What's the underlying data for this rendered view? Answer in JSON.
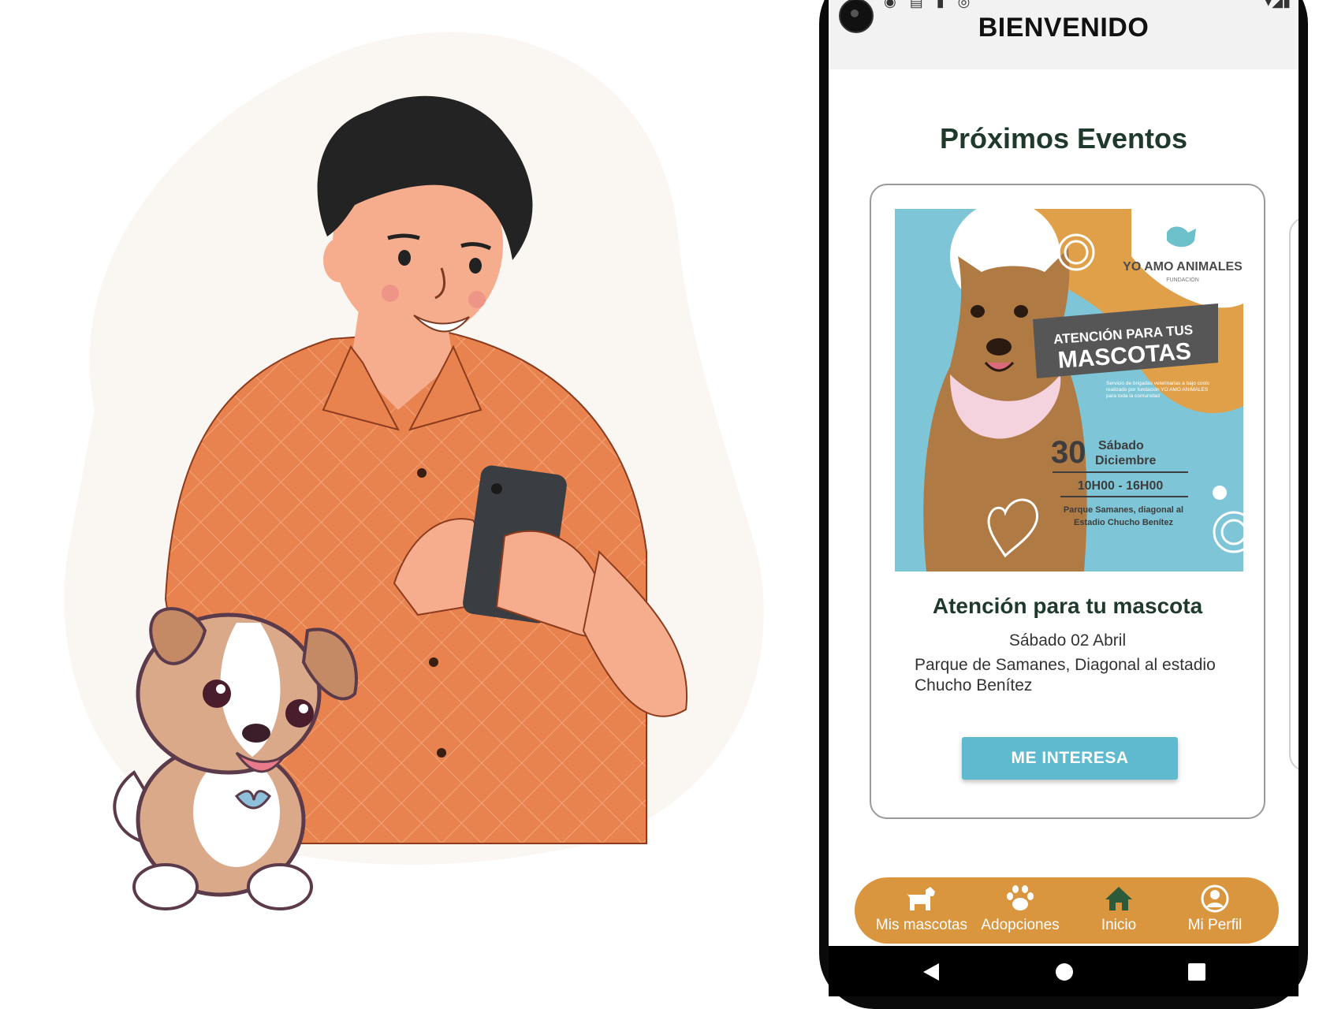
{
  "app": {
    "title": "BIENVENIDO",
    "section_title": "Próximos Eventos"
  },
  "event": {
    "title": "Atención para tu mascota",
    "date": "Sábado 02 Abril",
    "place": "Parque de Samanes, Diagonal al estadio Chucho Benítez",
    "button_label": "ME INTERESA",
    "poster": {
      "brand": "YO AMO ANIMALES",
      "brand_sub": "FUNDACIÓN",
      "headline_1": "ATENCIÓN PARA TUS",
      "headline_2": "MASCOTAS",
      "blurb": "Servicio de brigadas veterinarias a bajo costo realizado por fundación YO AMO ANIMALES para toda la comunidad",
      "day_number": "30",
      "day_name": "Sábado",
      "month": "Diciembre",
      "hours": "10H00 - 16H00",
      "location_1": "Parque Samanes, diagonal al",
      "location_2": "Estadio Chucho Benítez"
    }
  },
  "nav": {
    "items": [
      {
        "label": "Mis mascotas",
        "icon": "dog-icon"
      },
      {
        "label": "Adopciones",
        "icon": "paw-icon"
      },
      {
        "label": "Inicio",
        "icon": "home-icon"
      },
      {
        "label": "Mi Perfil",
        "icon": "profile-icon"
      }
    ]
  },
  "colors": {
    "accent_orange": "#d9963f",
    "button_blue": "#5fb9cf",
    "title_green": "#1f3a2c",
    "poster_blue": "#7ec6d7",
    "poster_orange": "#e0a04a",
    "shirt_orange": "#e8834f"
  }
}
